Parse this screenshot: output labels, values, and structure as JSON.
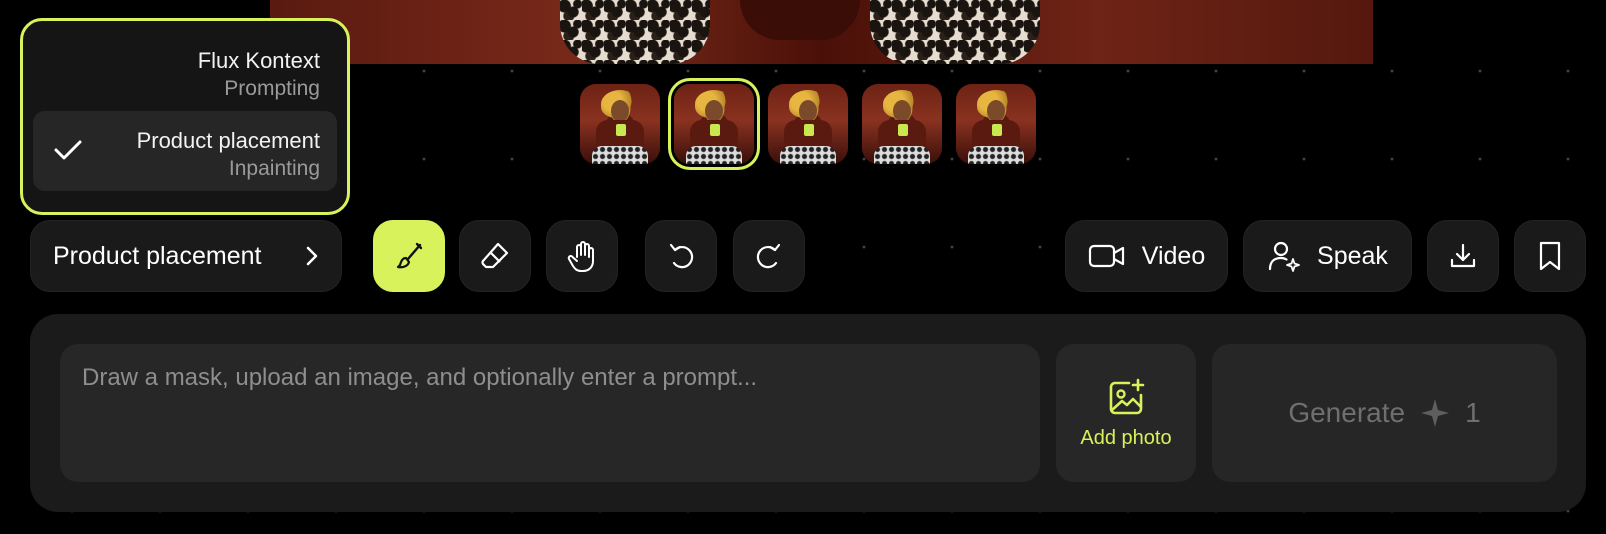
{
  "menu": {
    "options": [
      {
        "title": "Flux Kontext",
        "subtitle": "Prompting",
        "selected": false
      },
      {
        "title": "Product placement",
        "subtitle": "Inpainting",
        "selected": true
      }
    ]
  },
  "thumbnails": {
    "count": 5,
    "selected_index": 1
  },
  "toolbar": {
    "model_label": "Product placement",
    "tools": [
      "brush-icon",
      "eraser-icon",
      "hand-icon",
      "undo-icon",
      "redo-icon"
    ],
    "active_tool": "brush-icon",
    "video_label": "Video",
    "speak_label": "Speak"
  },
  "composer": {
    "placeholder": "Draw a mask, upload an image, and optionally enter a prompt...",
    "add_photo_label": "Add photo",
    "generate_label": "Generate",
    "generate_cost": "1"
  },
  "colors": {
    "accent": "#d7f25a",
    "background": "#000000",
    "surface": "#1b1b1b"
  }
}
